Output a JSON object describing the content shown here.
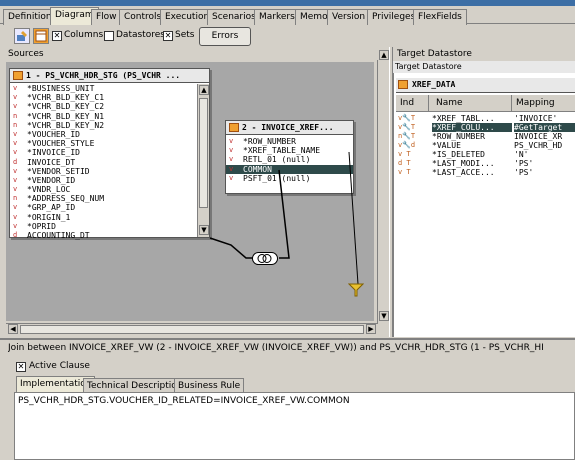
{
  "tabs": [
    {
      "label": "Definition"
    },
    {
      "label": "Diagram"
    },
    {
      "label": "Flow"
    },
    {
      "label": "Controls"
    },
    {
      "label": "Execution"
    },
    {
      "label": "Scenarios"
    },
    {
      "label": "Markers"
    },
    {
      "label": "Memo"
    },
    {
      "label": "Version"
    },
    {
      "label": "Privileges"
    },
    {
      "label": "FlexFields"
    }
  ],
  "toolbar": {
    "columns_label": "Columns",
    "datastores_label": "Datastores",
    "sets_label": "Sets",
    "errors_label": "Errors"
  },
  "sources": {
    "title": "Sources",
    "table1": {
      "title": "1 - PS_VCHR_HDR_STG (PS_VCHR ...",
      "rows": [
        "*BUSINESS_UNIT",
        "*VCHR_BLD_KEY_C1",
        "*VCHR_BLD_KEY_C2",
        "*VCHR_BLD_KEY_N1",
        "*VCHR_BLD_KEY_N2",
        "*VOUCHER_ID",
        "*VOUCHER_STYLE",
        "*INVOICE_ID",
        "INVOICE_DT",
        "*VENDOR_SETID",
        "*VENDOR_ID",
        "*VNDR_LOC",
        "*ADDRESS_SEQ_NUM",
        "*GRP_AP_ID",
        "*ORIGIN_1",
        "*OPRID",
        "ACCOUNTING_DT"
      ]
    },
    "table2": {
      "title": "2 - INVOICE_XREF...",
      "rows": [
        "*ROW_NUMBER",
        "*XREF_TABLE_NAME",
        "RETL_01 (null)",
        "COMMON",
        "PSFT_01 (null)"
      ]
    }
  },
  "target": {
    "title": "Target Datastore",
    "subtitle": "Target Datastore",
    "table_name": "XREF_DATA",
    "columns": [
      "Ind",
      "Name",
      "Mapping"
    ],
    "rows": [
      {
        "name": "*XREF_TABL...",
        "mapping": "'INVOICE'"
      },
      {
        "name": "*XREF_COLU...",
        "mapping": "#GetTarget"
      },
      {
        "name": "*ROW_NUMBER",
        "mapping": "INVOICE_XR"
      },
      {
        "name": "*VALUE",
        "mapping": "PS_VCHR_HD"
      },
      {
        "name": "*IS_DELETED",
        "mapping": "'N'"
      },
      {
        "name": "*LAST_MODI...",
        "mapping": "'PS'"
      },
      {
        "name": "*LAST_ACCE...",
        "mapping": "'PS'"
      }
    ]
  },
  "join": {
    "text": "Join between INVOICE_XREF_VW (2 - INVOICE_XREF_VW (INVOICE_XREF_VW)) and PS_VCHR_HDR_STG (1 - PS_VCHR_HI"
  },
  "active_clause_label": "Active Clause",
  "bottom_tabs": [
    {
      "label": "Implementation"
    },
    {
      "label": "Technical Description"
    },
    {
      "label": "Business Rule"
    }
  ],
  "implementation_text": "PS_VCHR_HDR_STG.VOUCHER_ID_RELATED=INVOICE_XREF_VW.COMMON",
  "colors": {
    "canvas": "#a7a7a7",
    "selected": "#2e4a4a",
    "tab_strip": "#3c6ea5"
  }
}
